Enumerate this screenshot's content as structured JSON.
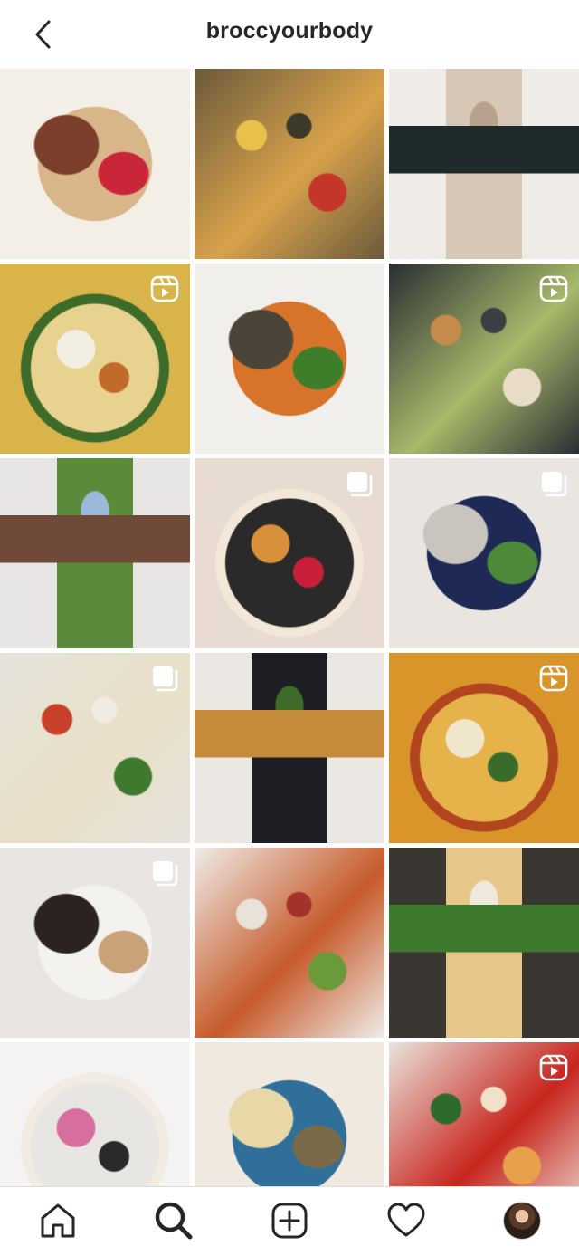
{
  "header": {
    "title": "broccyourbody",
    "back_icon": "chevron-left-icon"
  },
  "grid": {
    "tiles": [
      {
        "name": "tile-oatmeal-berries",
        "badge": "none",
        "colors": [
          "#f3eee6",
          "#d8b68a",
          "#7a3e2a",
          "#c9263a",
          "#2c3a78"
        ]
      },
      {
        "name": "tile-chicken-fajita-peppers",
        "badge": "none",
        "colors": [
          "#6b5a3c",
          "#d8a24a",
          "#c4352a",
          "#e8c04a",
          "#3b3a2a"
        ]
      },
      {
        "name": "tile-woman-kitchen-smoothie",
        "badge": "none",
        "colors": [
          "#efece8",
          "#d7c7b6",
          "#f5f1ec",
          "#1f2a2c",
          "#b8a28d"
        ]
      },
      {
        "name": "tile-frittata-feta",
        "badge": "reel",
        "colors": [
          "#d9b44a",
          "#e7d28f",
          "#f2efe2",
          "#3e6b2a",
          "#c26a2a"
        ]
      },
      {
        "name": "tile-sweet-potato-lentil-salad",
        "badge": "none",
        "colors": [
          "#f1efec",
          "#d8732a",
          "#4b4438",
          "#3e7d2a",
          "#ece7df"
        ]
      },
      {
        "name": "tile-avocado-toast-platter",
        "badge": "reel",
        "colors": [
          "#2a2e33",
          "#a7b96a",
          "#e8dcc8",
          "#c48b4a",
          "#3b3f44"
        ]
      },
      {
        "name": "tile-woman-green-cardigan",
        "badge": "none",
        "colors": [
          "#e8e6e4",
          "#5a8a3a",
          "#c8a088",
          "#6f4a38",
          "#9ab9d8"
        ]
      },
      {
        "name": "tile-skillet-egg-hash",
        "badge": "multi",
        "colors": [
          "#e7dbd2",
          "#2a2a2a",
          "#d8903a",
          "#f2e7d8",
          "#c8203a"
        ]
      },
      {
        "name": "tile-woman-denim-kitchen",
        "badge": "multi",
        "colors": [
          "#e9e6e1",
          "#1e2a55",
          "#c9c4bd",
          "#4c8a3a",
          "#efcc3a"
        ]
      },
      {
        "name": "tile-cheesy-pizza-salad",
        "badge": "multi",
        "colors": [
          "#e6e2dc",
          "#e8e0c8",
          "#3e7a2e",
          "#c8402a",
          "#f0ebe4"
        ]
      },
      {
        "name": "tile-frittata-slice-checked-napkin",
        "badge": "none",
        "colors": [
          "#ebe7e2",
          "#1d1f24",
          "#f4f1ec",
          "#c58a3a",
          "#3d6b2a"
        ]
      },
      {
        "name": "tile-dumplings-curry-broth",
        "badge": "reel",
        "colors": [
          "#d9952a",
          "#e6b24a",
          "#f0e6cc",
          "#b2441e",
          "#3b6b2a"
        ]
      },
      {
        "name": "tile-woman-sunglasses-sandwich",
        "badge": "multi",
        "colors": [
          "#e8e5e2",
          "#f4f2ef",
          "#2a2320",
          "#c9a27a",
          "#c8c2bb"
        ]
      },
      {
        "name": "tile-shrimp-bowl",
        "badge": "none",
        "colors": [
          "#efece8",
          "#c65a2a",
          "#6b9a3a",
          "#e8e2d8",
          "#a3332a"
        ]
      },
      {
        "name": "tile-skillet-risotto-egg",
        "badge": "none",
        "colors": [
          "#3a3632",
          "#e7c788",
          "#d8803a",
          "#3e7a2e",
          "#efe8dc"
        ]
      },
      {
        "name": "tile-woman-pink-cardigan",
        "badge": "none",
        "colors": [
          "#f4f3f2",
          "#e8e6e2",
          "#d76ea0",
          "#f1ebe4",
          "#2a2a2a"
        ]
      },
      {
        "name": "tile-lemon-chicken-soup",
        "badge": "none",
        "colors": [
          "#efe9e0",
          "#2f6f9a",
          "#e8d8a8",
          "#7a6a4a",
          "#f3efe6"
        ]
      },
      {
        "name": "tile-tomato-bruschetta",
        "badge": "reel",
        "colors": [
          "#e9e4dc",
          "#c8251e",
          "#e8a04a",
          "#2e6a2a",
          "#f0e2c8"
        ]
      }
    ],
    "partial_row_colors": [
      "#c8c4b8",
      "#e4e2df",
      "#8a6a4a"
    ]
  },
  "bottom_nav": {
    "items": [
      {
        "name": "nav-home",
        "icon": "home-icon"
      },
      {
        "name": "nav-search",
        "icon": "search-icon",
        "active": true
      },
      {
        "name": "nav-create",
        "icon": "plus-square-icon"
      },
      {
        "name": "nav-activity",
        "icon": "heart-icon"
      },
      {
        "name": "nav-profile",
        "icon": "profile-avatar"
      }
    ]
  },
  "colors": {
    "text": "#262626",
    "border": "#dbdbdb",
    "background": "#ffffff"
  }
}
